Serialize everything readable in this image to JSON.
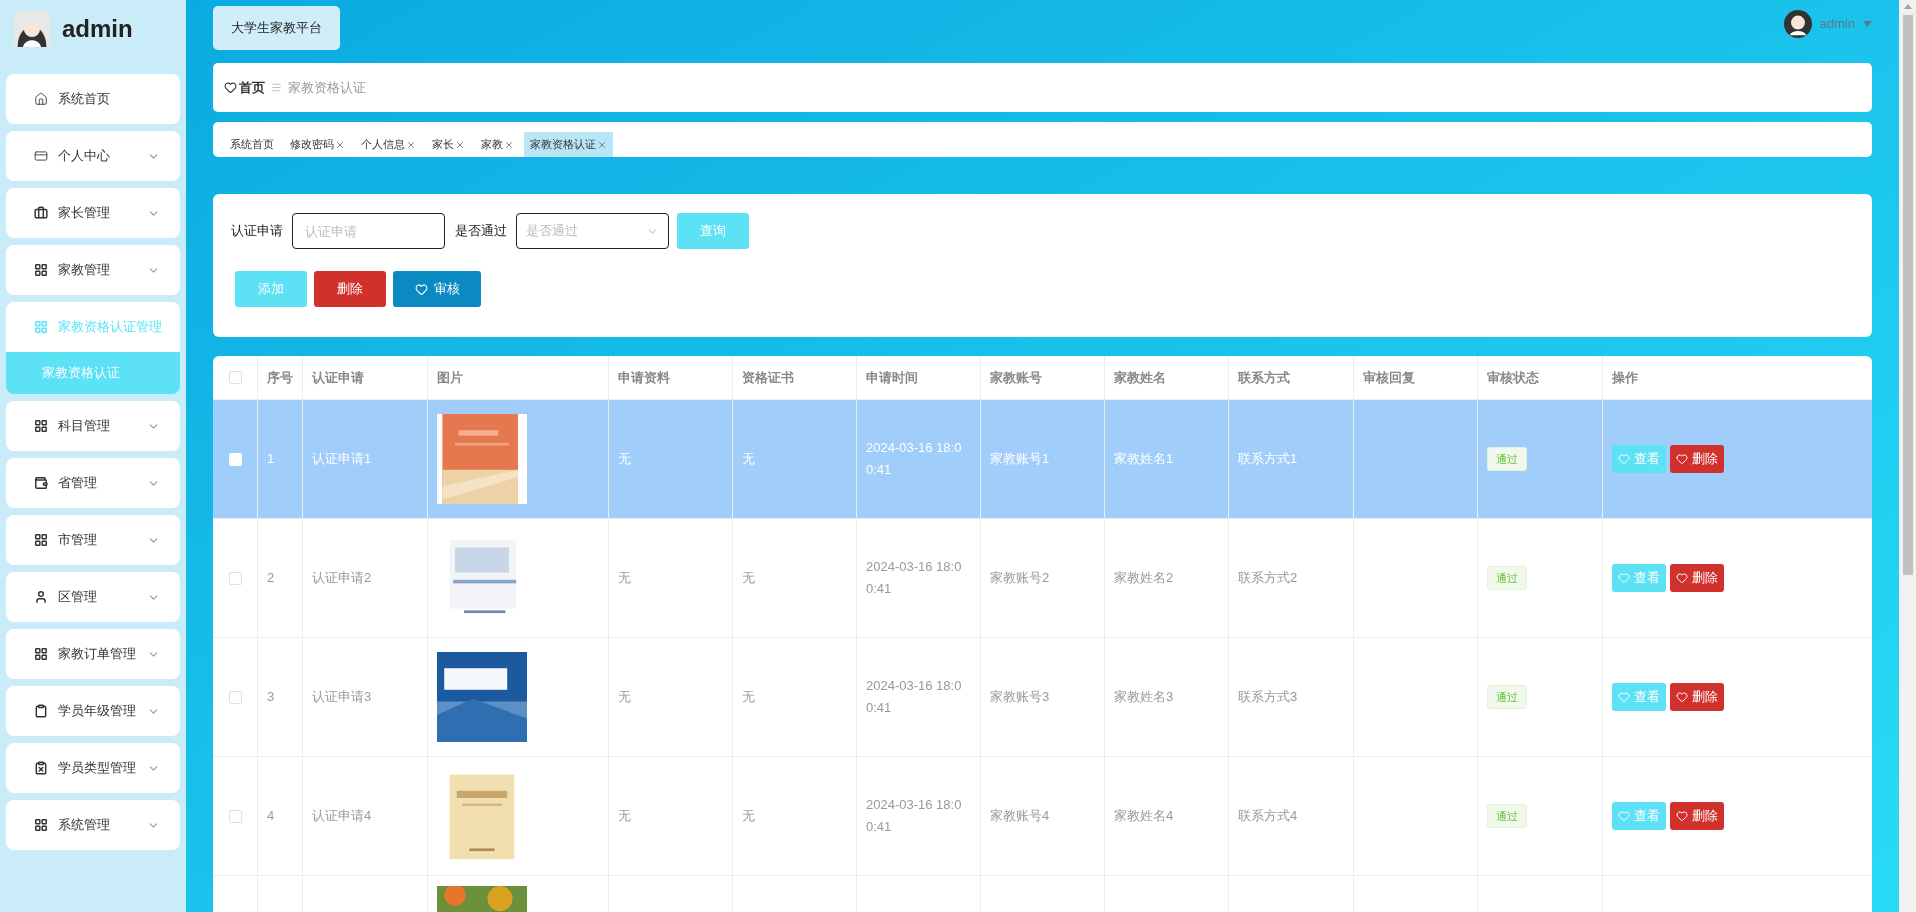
{
  "sidebar": {
    "user": "admin",
    "items": [
      {
        "label": "系统首页",
        "expanded": false,
        "active": false,
        "has_caret": false
      },
      {
        "label": "个人中心",
        "expanded": false,
        "active": false,
        "has_caret": true
      },
      {
        "label": "家长管理",
        "expanded": false,
        "active": false,
        "has_caret": true
      },
      {
        "label": "家教管理",
        "expanded": false,
        "active": false,
        "has_caret": true
      },
      {
        "label": "家教资格认证管理",
        "expanded": true,
        "active": true,
        "has_caret": false,
        "children": [
          {
            "label": "家教资格认证",
            "selected": true
          }
        ]
      },
      {
        "label": "科目管理",
        "expanded": false,
        "active": false,
        "has_caret": true
      },
      {
        "label": "省管理",
        "expanded": false,
        "active": false,
        "has_caret": true
      },
      {
        "label": "市管理",
        "expanded": false,
        "active": false,
        "has_caret": true
      },
      {
        "label": "区管理",
        "expanded": false,
        "active": false,
        "has_caret": true
      },
      {
        "label": "家教订单管理",
        "expanded": false,
        "active": false,
        "has_caret": true
      },
      {
        "label": "学员年级管理",
        "expanded": false,
        "active": false,
        "has_caret": true
      },
      {
        "label": "学员类型管理",
        "expanded": false,
        "active": false,
        "has_caret": true
      },
      {
        "label": "系统管理",
        "expanded": false,
        "active": false,
        "has_caret": true
      }
    ]
  },
  "header": {
    "platform_button": "大学生家教平台",
    "user": "admin"
  },
  "breadcrumb": {
    "home": "首页",
    "current": "家教资格认证"
  },
  "tags": [
    {
      "label": "系统首页",
      "closable": false,
      "selected": false
    },
    {
      "label": "修改密码",
      "closable": true,
      "selected": false
    },
    {
      "label": "个人信息",
      "closable": true,
      "selected": false
    },
    {
      "label": "家长",
      "closable": true,
      "selected": false
    },
    {
      "label": "家教",
      "closable": true,
      "selected": false
    },
    {
      "label": "家教资格认证",
      "closable": true,
      "selected": true
    }
  ],
  "search": {
    "fields": [
      {
        "label": "认证申请",
        "kind": "input",
        "placeholder": "认证申请"
      },
      {
        "label": "是否通过",
        "kind": "select",
        "placeholder": "是否通过"
      }
    ],
    "query_button": "查询"
  },
  "actions": [
    {
      "label": "添加",
      "kind": "add"
    },
    {
      "label": "删除",
      "kind": "delete"
    },
    {
      "label": "审核",
      "kind": "review"
    }
  ],
  "table": {
    "select_all_checked": false,
    "columns": [
      "序号",
      "认证申请",
      "图片",
      "申请资料",
      "资格证书",
      "申请时间",
      "家教账号",
      "家教姓名",
      "联系方式",
      "审核回复",
      "审核状态",
      "操作"
    ],
    "rows": [
      {
        "kind": "full",
        "selected": true,
        "checked": false,
        "no": "1",
        "application": "认证申请1",
        "materials": "无",
        "certificate": "无",
        "time": "2024-03-16 18:00:41",
        "account": "家教账号1",
        "name": "家教姓名1",
        "contact": "联系方式1",
        "status": "通过",
        "view": "查看",
        "delete": "删除"
      },
      {
        "kind": "full",
        "selected": false,
        "checked": false,
        "no": "2",
        "application": "认证申请2",
        "materials": "无",
        "certificate": "无",
        "time": "2024-03-16 18:00:41",
        "account": "家教账号2",
        "name": "家教姓名2",
        "contact": "联系方式2",
        "status": "通过",
        "view": "查看",
        "delete": "删除"
      },
      {
        "kind": "full",
        "selected": false,
        "checked": false,
        "no": "3",
        "application": "认证申请3",
        "materials": "无",
        "certificate": "无",
        "time": "2024-03-16 18:00:41",
        "account": "家教账号3",
        "name": "家教姓名3",
        "contact": "联系方式3",
        "status": "通过",
        "view": "查看",
        "delete": "删除"
      },
      {
        "kind": "full",
        "selected": false,
        "checked": false,
        "no": "4",
        "application": "认证申请4",
        "materials": "无",
        "certificate": "无",
        "time": "2024-03-16 18:00:41",
        "account": "家教账号4",
        "name": "家教姓名4",
        "contact": "联系方式4",
        "status": "通过",
        "view": "查看",
        "delete": "删除"
      },
      {
        "kind": "clipped",
        "selected": false
      }
    ]
  }
}
